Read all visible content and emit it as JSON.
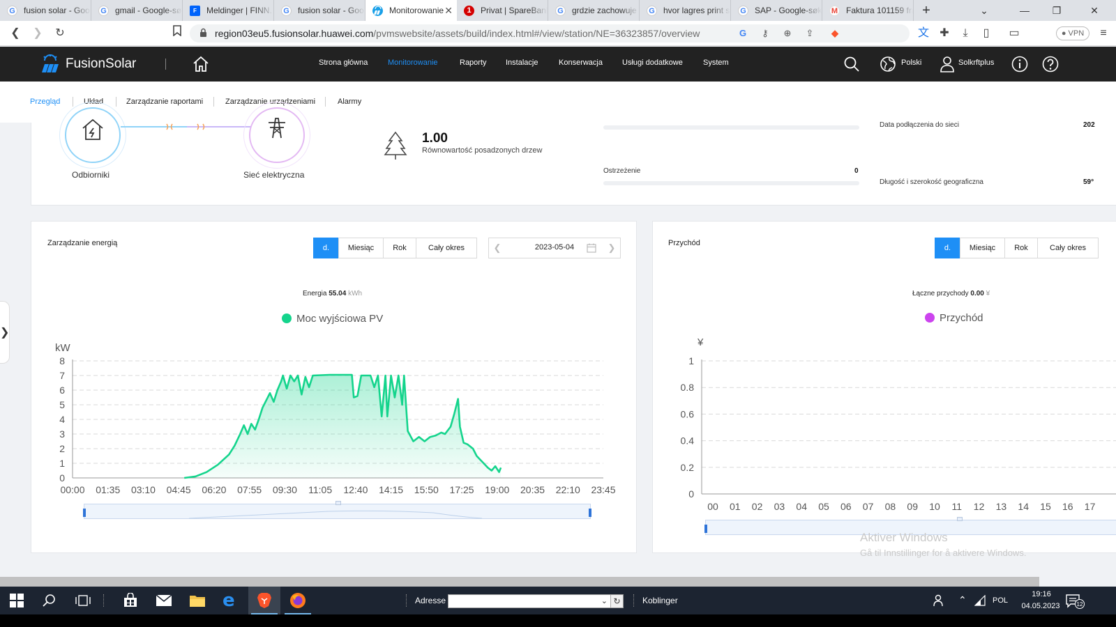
{
  "browser": {
    "tabs": [
      {
        "title": "fusion solar - Goo",
        "icon": "google-icon",
        "fav": "G",
        "cls": "fav-g"
      },
      {
        "title": "gmail - Google-sø",
        "icon": "google-icon",
        "fav": "G",
        "cls": "fav-g"
      },
      {
        "title": "Meldinger | FINN.",
        "icon": "finn-icon",
        "fav": "F",
        "cls": "fav-finn"
      },
      {
        "title": "fusion solar - Goo",
        "icon": "google-icon",
        "fav": "G",
        "cls": "fav-g"
      },
      {
        "title": "Monitorowanie",
        "icon": "fusionsolar-icon",
        "fav": "",
        "cls": "fav-fs",
        "active": true
      },
      {
        "title": "Privat | SpareBank",
        "icon": "sparebank-icon",
        "fav": "1",
        "cls": "fav-sb"
      },
      {
        "title": "grdzie zachowuje",
        "icon": "google-icon",
        "fav": "G",
        "cls": "fav-g"
      },
      {
        "title": "hvor lagres print s",
        "icon": "google-icon",
        "fav": "G",
        "cls": "fav-g"
      },
      {
        "title": "SAP - Google-søk",
        "icon": "google-icon",
        "fav": "G",
        "cls": "fav-g"
      },
      {
        "title": "Faktura 101159 fra",
        "icon": "gmail-icon",
        "fav": "M",
        "cls": "fav-gm"
      }
    ],
    "url_host": "region03eu5.fusionsolar.huawei.com",
    "url_path": "/pvmswebsite/assets/build/index.html#/view/station/NE=36323857/overview",
    "vpn_label": "VPN"
  },
  "header": {
    "logo_text": "FusionSolar",
    "nav": [
      {
        "label": "Strona główna"
      },
      {
        "label": "Monitorowanie",
        "active": true
      },
      {
        "label": "Raporty"
      },
      {
        "label": "Instalacje"
      },
      {
        "label": "Konserwacja"
      },
      {
        "label": "Usługi dodatkowe"
      },
      {
        "label": "System"
      }
    ],
    "language": "Polski",
    "user": "Solkrftplus"
  },
  "subnav": {
    "items": [
      {
        "label": "Przegląd",
        "active": true
      },
      {
        "label": "Układ"
      },
      {
        "label": "Zarządzanie raportami"
      },
      {
        "label": "Zarządzanie urządzeniami"
      },
      {
        "label": "Alarmy"
      }
    ]
  },
  "overview": {
    "consumers_label": "Odbiorniki",
    "grid_label": "Sieć elektryczna",
    "trees_value": "1.00",
    "trees_label": "Równowartość posadzonych drzew",
    "warning_label": "Ostrzeżenie",
    "warning_value": "0",
    "grid_connection_label": "Data podłączenia do sieci",
    "grid_connection_value": "202",
    "geo_label": "Długość i szerokość geograficzna",
    "geo_value": "59°"
  },
  "energy": {
    "title": "Zarządzanie energią",
    "periods": [
      "d.",
      "Miesiąc",
      "Rok",
      "Cały okres"
    ],
    "active_period": 0,
    "date": "2023-05-04",
    "summary_label": "Energia",
    "summary_value": "55.04",
    "summary_unit": "kWh",
    "legend": "Moc wyjściowa PV",
    "series_color": "#14d48c"
  },
  "revenue": {
    "title": "Przychód",
    "periods": [
      "d.",
      "Miesiąc",
      "Rok",
      "Cały okres"
    ],
    "active_period": 0,
    "summary_label": "Łączne przychody",
    "summary_value": "0.00",
    "summary_unit": "¥",
    "legend": "Przychód",
    "series_color": "#cc44ee"
  },
  "chart_data": [
    {
      "type": "area",
      "ylabel": "kW",
      "ylim": [
        0,
        8
      ],
      "yticks": [
        0,
        1,
        2,
        3,
        4,
        5,
        6,
        7,
        8
      ],
      "xticks": [
        "00:00",
        "01:35",
        "03:10",
        "04:45",
        "06:20",
        "07:55",
        "09:30",
        "11:05",
        "12:40",
        "14:15",
        "15:50",
        "17:25",
        "19:00",
        "20:35",
        "22:10",
        "23:45"
      ],
      "series": [
        {
          "name": "Moc wyjściowa PV",
          "points": [
            [
              "05:00",
              0
            ],
            [
              "05:30",
              0.1
            ],
            [
              "06:00",
              0.4
            ],
            [
              "06:30",
              0.9
            ],
            [
              "07:00",
              1.6
            ],
            [
              "07:15",
              2.2
            ],
            [
              "07:30",
              3.0
            ],
            [
              "07:40",
              3.6
            ],
            [
              "07:50",
              3.0
            ],
            [
              "08:00",
              3.7
            ],
            [
              "08:10",
              3.3
            ],
            [
              "08:20",
              4.0
            ],
            [
              "08:30",
              4.8
            ],
            [
              "08:40",
              5.3
            ],
            [
              "08:50",
              5.8
            ],
            [
              "09:00",
              5.2
            ],
            [
              "09:10",
              6.0
            ],
            [
              "09:20",
              6.6
            ],
            [
              "09:25",
              7.0
            ],
            [
              "09:35",
              6.1
            ],
            [
              "09:45",
              7.0
            ],
            [
              "09:55",
              6.6
            ],
            [
              "10:05",
              7.0
            ],
            [
              "10:15",
              5.7
            ],
            [
              "10:25",
              6.9
            ],
            [
              "10:35",
              6.2
            ],
            [
              "10:45",
              7.0
            ],
            [
              "11:30",
              7.05
            ],
            [
              "12:10",
              7.05
            ],
            [
              "12:30",
              7.05
            ],
            [
              "12:35",
              5.5
            ],
            [
              "12:45",
              5.6
            ],
            [
              "12:55",
              7.0
            ],
            [
              "13:20",
              7.0
            ],
            [
              "13:30",
              6.2
            ],
            [
              "13:40",
              7.0
            ],
            [
              "13:50",
              4.2
            ],
            [
              "14:00",
              7.0
            ],
            [
              "14:05",
              4.2
            ],
            [
              "14:15",
              7.0
            ],
            [
              "14:25",
              5.5
            ],
            [
              "14:35",
              7.0
            ],
            [
              "14:45",
              5.0
            ],
            [
              "14:50",
              7.0
            ],
            [
              "15:00",
              3.2
            ],
            [
              "15:15",
              2.5
            ],
            [
              "15:30",
              2.8
            ],
            [
              "15:45",
              2.5
            ],
            [
              "16:00",
              2.8
            ],
            [
              "16:15",
              2.9
            ],
            [
              "16:30",
              3.1
            ],
            [
              "16:40",
              3.0
            ],
            [
              "16:55",
              3.5
            ],
            [
              "17:05",
              4.4
            ],
            [
              "17:15",
              5.4
            ],
            [
              "17:20",
              3.5
            ],
            [
              "17:30",
              2.4
            ],
            [
              "17:40",
              2.3
            ],
            [
              "17:55",
              2.0
            ],
            [
              "18:05",
              1.5
            ],
            [
              "18:20",
              1.1
            ],
            [
              "18:35",
              0.7
            ],
            [
              "18:45",
              0.5
            ],
            [
              "18:55",
              0.8
            ],
            [
              "19:05",
              0.4
            ],
            [
              "19:10",
              0.7
            ]
          ]
        }
      ]
    },
    {
      "type": "bar",
      "ylabel": "¥",
      "ylim": [
        0,
        1
      ],
      "yticks": [
        0,
        0.2,
        0.4,
        0.6,
        0.8,
        1
      ],
      "categories": [
        "00",
        "01",
        "02",
        "03",
        "04",
        "05",
        "06",
        "07",
        "08",
        "09",
        "10",
        "11",
        "12",
        "13",
        "14",
        "15",
        "16",
        "17"
      ],
      "series": [
        {
          "name": "Przychód",
          "values": []
        }
      ]
    }
  ],
  "windows": {
    "watermark_title": "Aktiver Windows",
    "watermark_sub": "Gå til Innstillinger for å aktivere Windows."
  },
  "taskbar": {
    "address_label": "Adresse",
    "links_label": "Koblinger",
    "language": "POL",
    "time": "19:16",
    "date": "04.05.2023",
    "notifications": "12"
  }
}
